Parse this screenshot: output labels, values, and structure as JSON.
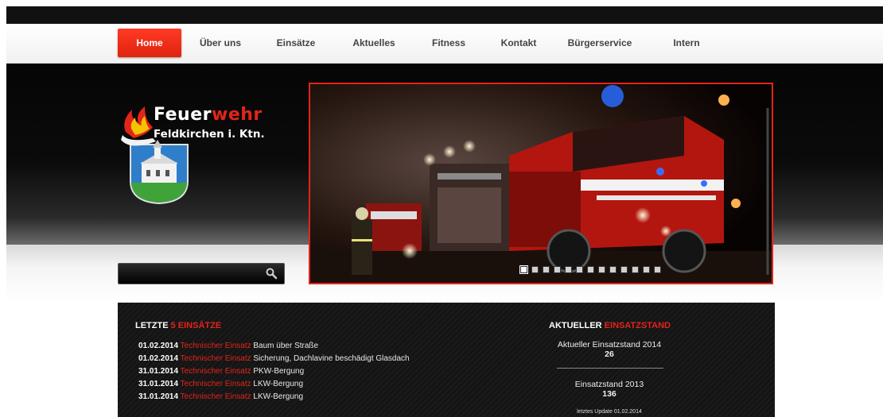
{
  "nav": {
    "items": [
      {
        "label": "Home"
      },
      {
        "label": "Über uns"
      },
      {
        "label": "Einsätze"
      },
      {
        "label": "Aktuelles"
      },
      {
        "label": "Fitness"
      },
      {
        "label": "Kontakt"
      },
      {
        "label": "Bürgerservice"
      },
      {
        "label": "Intern"
      }
    ],
    "active": "Home"
  },
  "logo": {
    "title_white": "Feuer",
    "title_red": "wehr",
    "subtitle": "Feldkirchen i. Ktn."
  },
  "search": {
    "value": "",
    "placeholder": ""
  },
  "slider": {
    "slide_count": 13,
    "active_index": 0
  },
  "einsaetze": {
    "heading_prefix": "LETZTE ",
    "heading_highlight": "5 EINSÄTZE",
    "rows": [
      {
        "date": "01.02.2014",
        "type": "Technischer Einsatz",
        "desc": "Baum über Straße"
      },
      {
        "date": "01.02.2014",
        "type": "Technischer Einsatz",
        "desc": "Sicherung, Dachlavine beschädigt Glasdach"
      },
      {
        "date": "31.01.2014",
        "type": "Technischer Einsatz",
        "desc": "PKW-Bergung"
      },
      {
        "date": "31.01.2014",
        "type": "Technischer Einsatz",
        "desc": "LKW-Bergung"
      },
      {
        "date": "31.01.2014",
        "type": "Technischer Einsatz",
        "desc": "LKW-Bergung"
      }
    ]
  },
  "einsatzstand": {
    "heading_prefix": "AKTUELLER ",
    "heading_highlight": "EINSATZSTAND",
    "current_label": "Aktueller Einsatzstand 2014",
    "current_value": "26",
    "previous_label": "Einsatzstand 2013",
    "previous_value": "136",
    "update_note": "letztes Update 01.02.2014"
  },
  "colors": {
    "accent": "#e3241a",
    "nav_active": "#e8301b",
    "panel_bg": "#141414"
  }
}
